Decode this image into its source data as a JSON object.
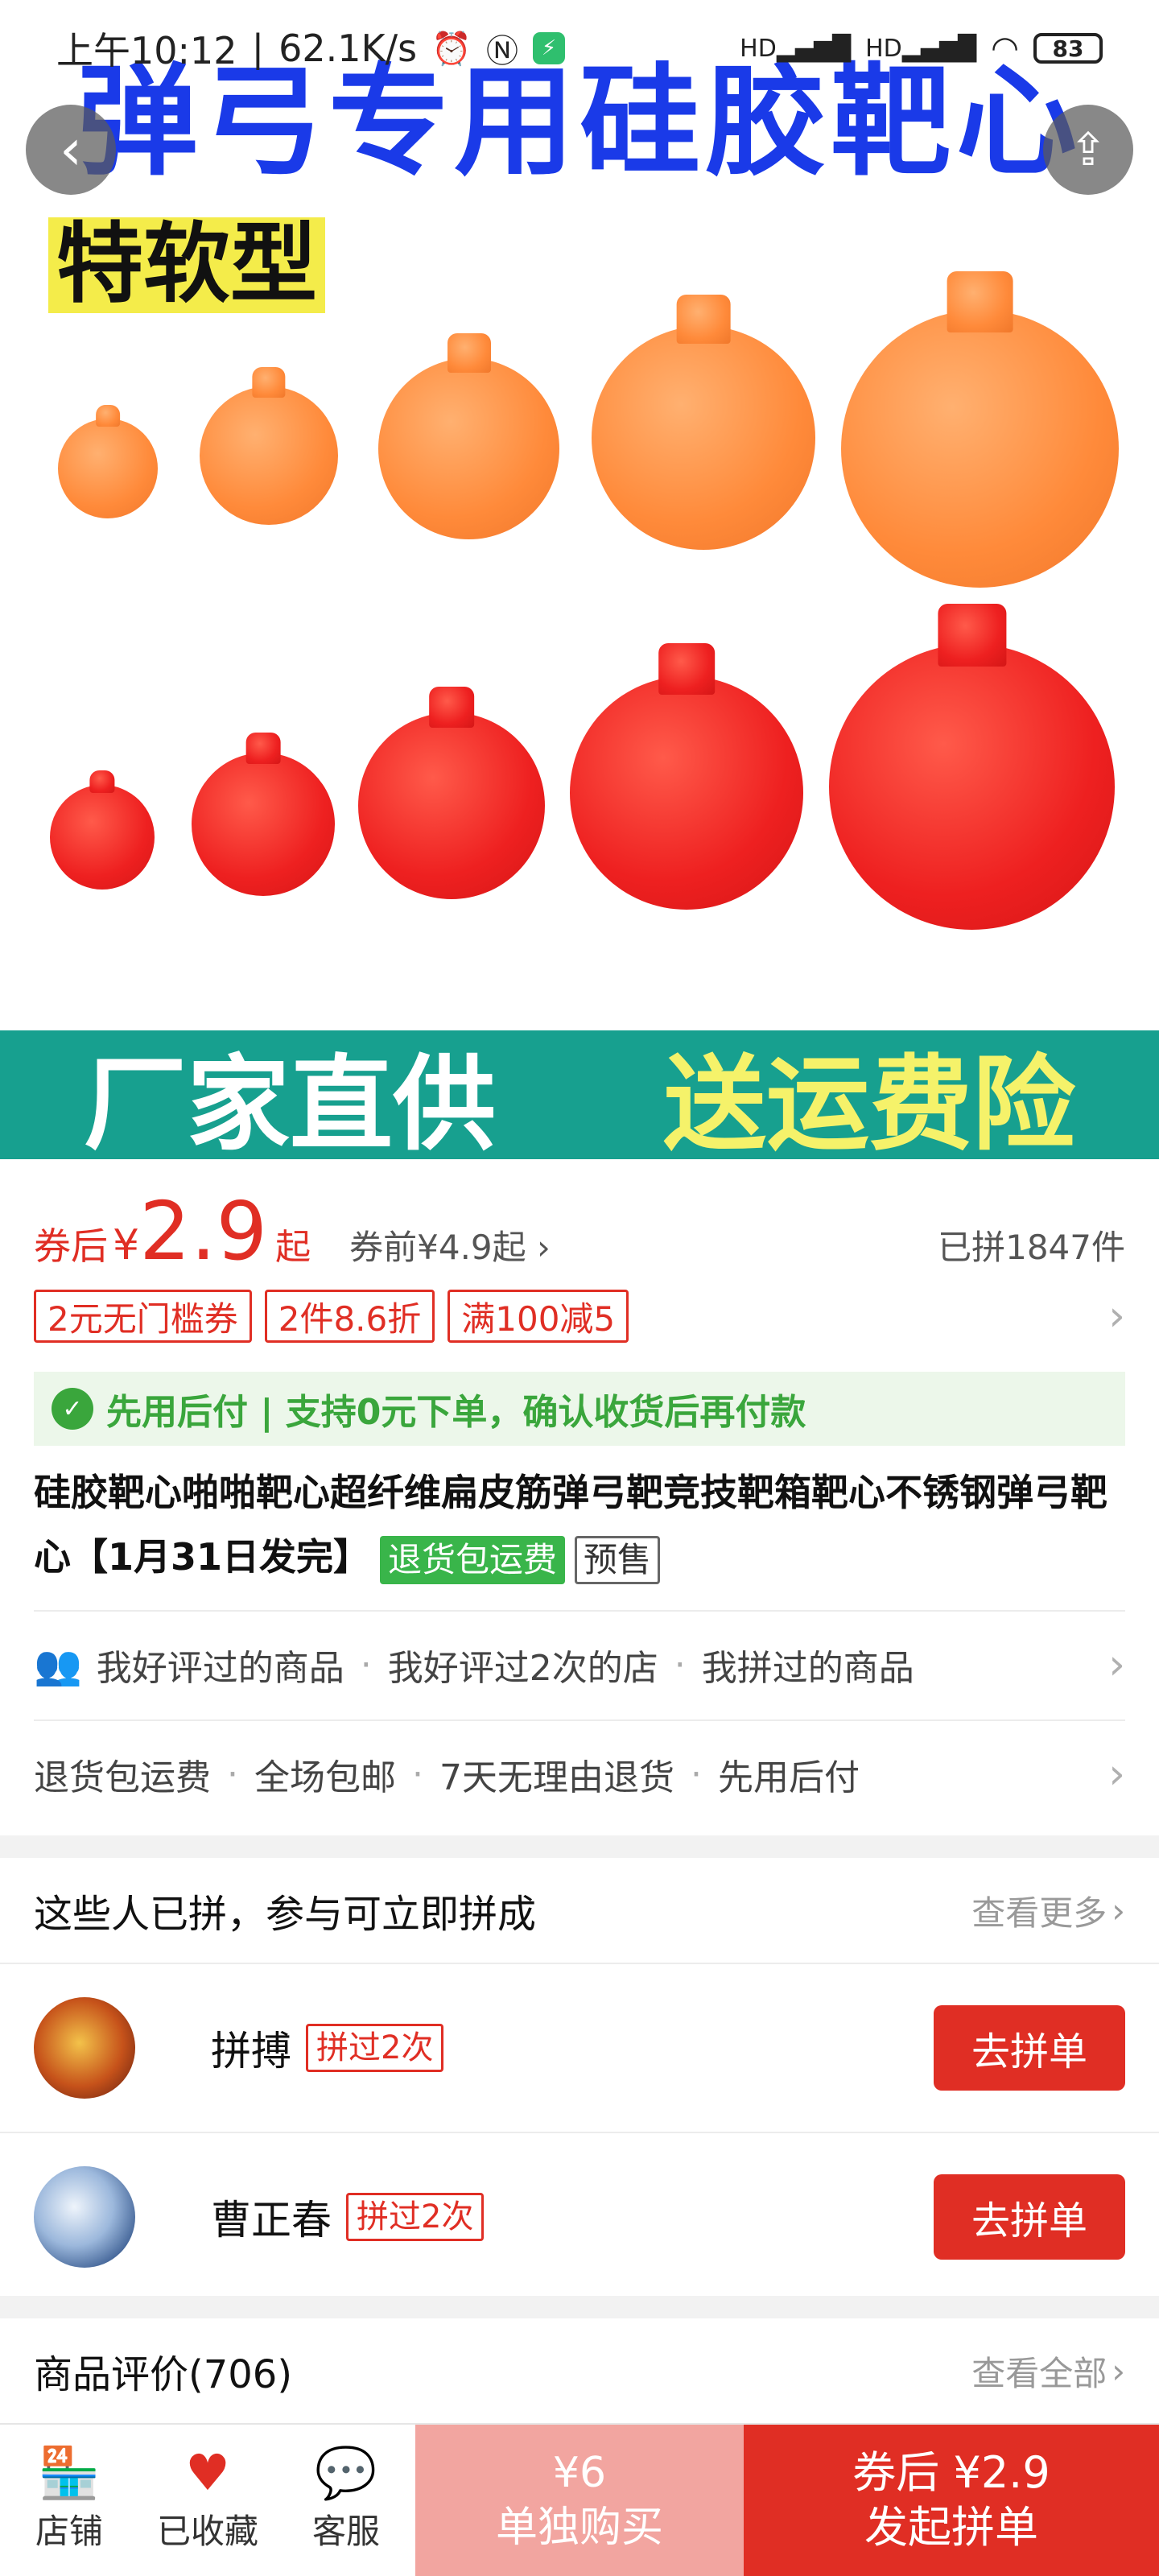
{
  "status_bar": {
    "time": "上午10:12",
    "net_speed": "62.1K/s",
    "battery": "83",
    "hd_label": "HD"
  },
  "hero": {
    "banner_title": "弹弓专用硅胶靶心",
    "sub_title": "特软型",
    "promo_left": "厂家直供",
    "promo_right": "送运费险"
  },
  "price": {
    "label": "券后",
    "currency": "¥",
    "value": "2.9",
    "suffix": "起",
    "before": "券前¥4.9起",
    "sold": "已拼1847件"
  },
  "coupons": [
    "2元无门槛券",
    "2件8.6折",
    "满100减5"
  ],
  "pay_later": {
    "text": "先用后付 | 支持0元下单，确认收货后再付款"
  },
  "product": {
    "title": "硅胶靶心啪啪靶心超纤维扁皮筋弹弓靶竞技靶箱靶心不锈钢弹弓靶心【1月31日发完】",
    "tag_return": "退货包运费",
    "tag_presale": "预售"
  },
  "social_row": [
    "我好评过的商品",
    "我好评过2次的店",
    "我拼过的商品"
  ],
  "service_row": [
    "退货包运费",
    "全场包邮",
    "7天无理由退货",
    "先用后付"
  ],
  "group": {
    "heading": "这些人已拼，参与可立即拼成",
    "more": "查看更多",
    "members": [
      {
        "name": "拼搏",
        "tag": "拼过2次",
        "button": "去拼单"
      },
      {
        "name": "曹正春",
        "tag": "拼过2次",
        "button": "去拼单"
      }
    ]
  },
  "reviews": {
    "heading": "商品评价(706)",
    "more": "查看全部"
  },
  "bottom_bar": {
    "store": "店铺",
    "favorited": "已收藏",
    "service": "客服",
    "solo_price": "¥6",
    "solo_label": "单独购买",
    "group_price": "券后 ¥2.9",
    "group_label": "发起拼单"
  },
  "colors": {
    "accent": "#e02e24",
    "banner_blue": "#1a3ae8",
    "promo_teal": "#17a08f",
    "pay_later_green": "#3aa63c"
  }
}
